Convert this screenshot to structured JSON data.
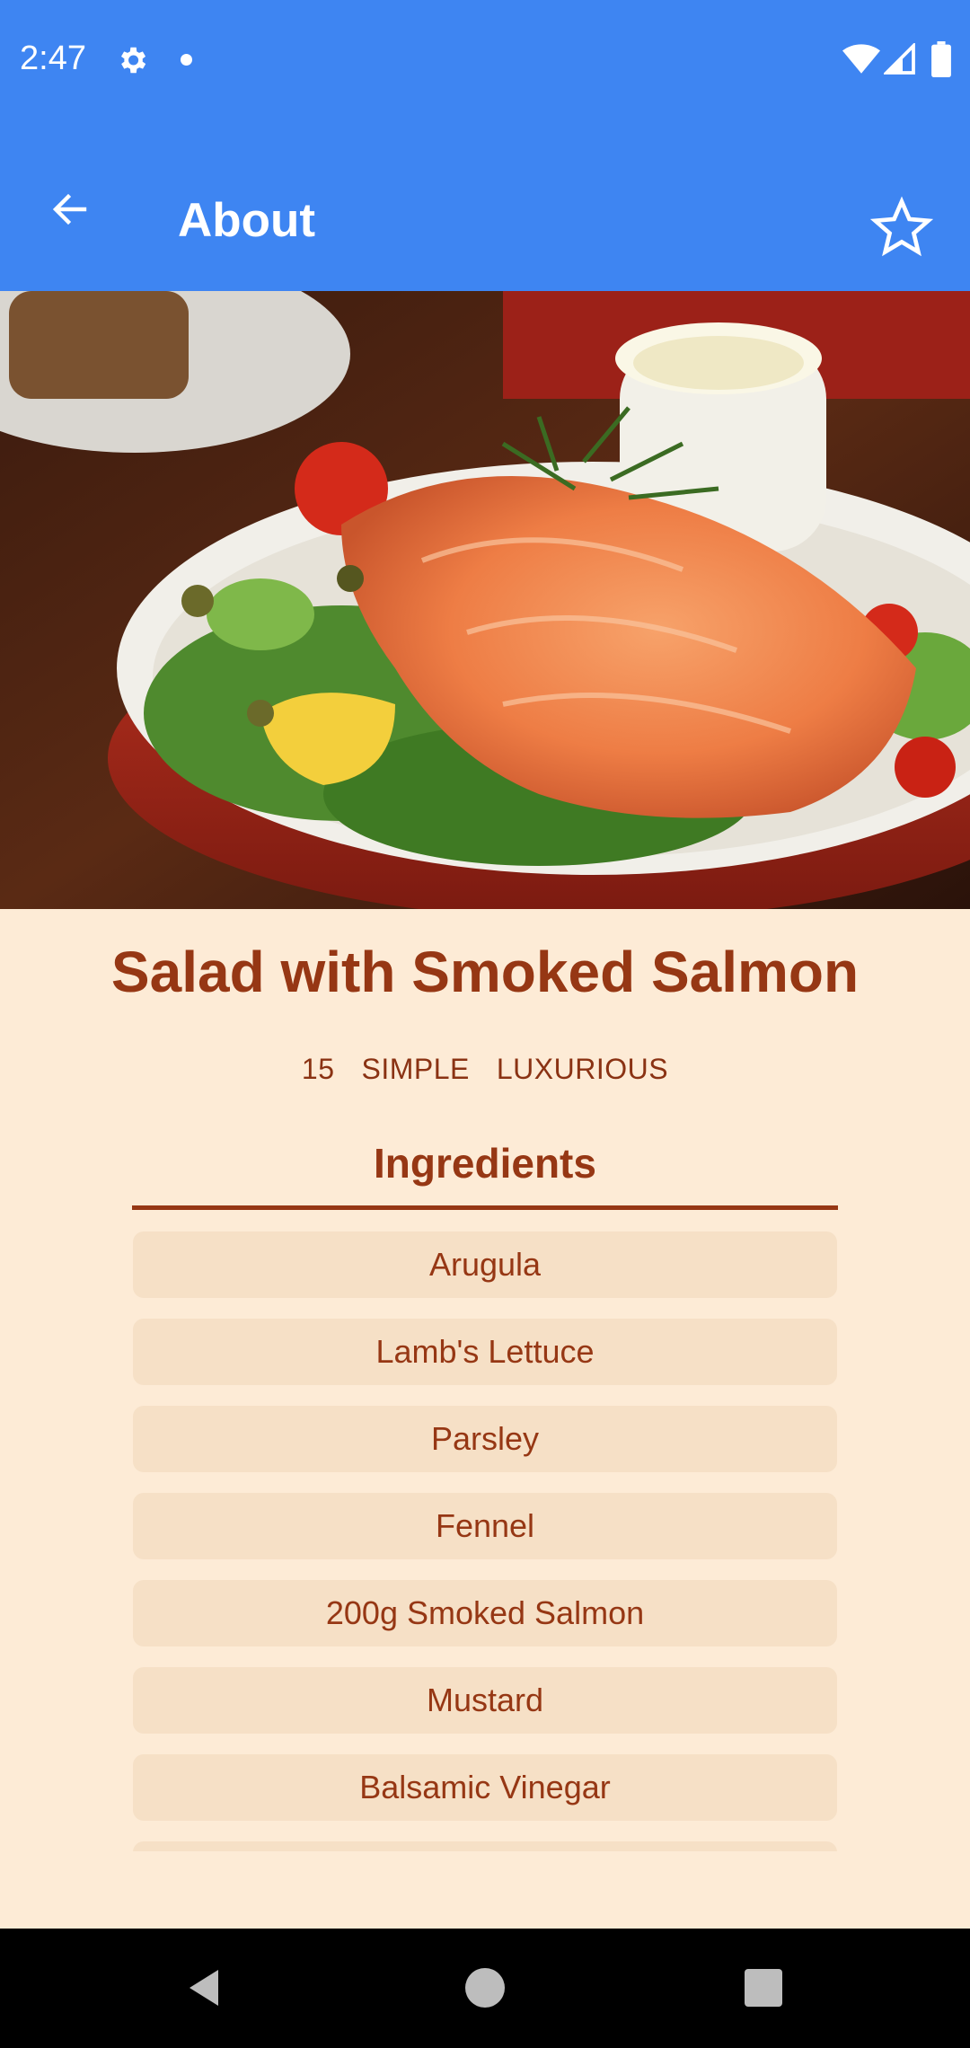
{
  "status_bar": {
    "time": "2:47",
    "icons": [
      "gear-icon",
      "notification-dot-icon",
      "wifi-icon",
      "signal-icon",
      "battery-icon"
    ]
  },
  "app_bar": {
    "title": "About",
    "back_icon": "arrow-back-icon",
    "favorite_icon": "star-outline-icon",
    "background_color": "#3e85f2"
  },
  "recipe": {
    "title": "Salad with Smoked Salmon",
    "meta": {
      "duration": "15",
      "complexity": "SIMPLE",
      "affordability": "LUXURIOUS"
    },
    "ingredients_heading": "Ingredients",
    "ingredients": [
      "Arugula",
      "Lamb's Lettuce",
      "Parsley",
      "Fennel",
      "200g Smoked Salmon",
      "Mustard",
      "Balsamic Vinegar",
      ""
    ]
  },
  "colors": {
    "accent": "#963714",
    "page_background": "#fdebd6",
    "chip_background": "#f6e0c6"
  },
  "nav_bar": {
    "icons": [
      "nav-back-icon",
      "nav-home-icon",
      "nav-recents-icon"
    ]
  }
}
